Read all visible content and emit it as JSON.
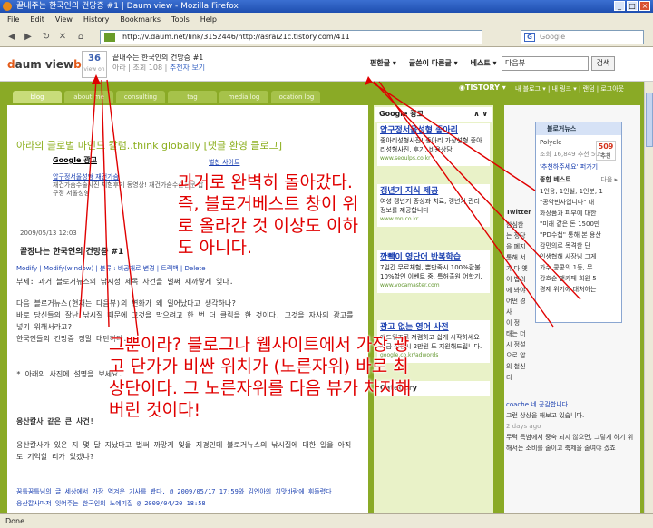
{
  "window": {
    "title": "끝내주는 한국인의 건망증 #1 | Daum view - Mozilla Firefox",
    "controls": [
      "_",
      "□",
      "×"
    ]
  },
  "menu": [
    "File",
    "Edit",
    "View",
    "History",
    "Bookmarks",
    "Tools",
    "Help"
  ],
  "nav": {
    "back": "◀",
    "forward": "▶",
    "reload": "↻",
    "stop": "✕",
    "home": "⌂",
    "url": "http://v.daum.net/link/3152446/http://asrai21c.tistory.com/411",
    "search_placeholder": "Google",
    "search_engine": "G"
  },
  "daum": {
    "logo_prefix": "d",
    "logo_main": "aum view",
    "logo_suffix": "b",
    "votes": "36",
    "votes_label": "view on",
    "post_title": "끝내주는 한국인의 건망증 #1",
    "post_meta": "아라 | 조회 108 |",
    "recommend_link": "추천자 보기",
    "nav_items": [
      "편한글 ▾",
      "글쓴이 다른글 ▾",
      "베스트 ▾"
    ],
    "search_value": "다음뷰",
    "search_button": "검색"
  },
  "blog": {
    "tabs": [
      "blog",
      "about me",
      "consulting",
      "tag",
      "media log",
      "location log"
    ],
    "tistory_label": "◉TISTORY ▾",
    "top_links": "내 블로그 ▾ | 내 링크 ▾ | 랜덤 | 로그아웃",
    "title": "아라의 글로벌 마인드 칼럼..think globally [댓글 환영 클로그]",
    "google_ad": "Google 광고",
    "ad1_title": "압구정서울성형 재건가슴",
    "ad1_text": "재건가슴수술사진 체험후기 동영상! 재건가슴수술전문 압구정 서울성형",
    "next_link": "별찬 사이트",
    "post_date": "2009/05/13 12:03",
    "post_title": "끝장나는 한국인의 건망증 #1",
    "post_links": "Modify | Modify(window) | 분류 : 비공개로 변경 | 트랙백 | Delete",
    "p1": "부제: 과거 블로거뉴스의 낚시성 제목 사건을 벌써 새까맣게 잊다.",
    "p2": "다음 블로거뉴스(현재는 다음뷰)의 변화가 왜 일어났다고 생각하나?\n바로 당신들의 잘난 낚시질 때문에 그것을 막으려고 한 번 더 클릭을 한 것이다. 그것을 자사의 광고를 넣기 위해서라고?\n한국인들의 건망증 정말 대단하다.",
    "p3": "* 아래의 사진에 설명을 보세요.",
    "p4": "응산칼사 같은 큰 사건!",
    "p5": "응산칼사가 있은 지 몇 달 지났다고 벌써 까맣게 잊을 지경인데 블로거뉴스의 낚시질에 대한 일을 아직도 기억할 리가 있겠냐?",
    "footer1": "꿈틀꿈틀님의 글 세상에서 가장 역겨운 기사를 봤다. @ 2009/05/17 17:59와 김연아의 치맛바람에 휘둘렸다",
    "footer2": "응산칼사마저 잊어주는 한국인의 노예기질 @ 2009/04/20 18:58"
  },
  "sidebar_ad": {
    "header": "Google 광고",
    "nav": "∧ ∨",
    "ads": [
      {
        "title": "압구정서울성형 종아리",
        "text": "종아리성형사진! 종아리 가상성형 종아리성형사진, 후기, 비용상담",
        "url": "www.seoulps.co.kr"
      },
      {
        "title": "갱년기 지식 제공",
        "text": "여성 갱년기 증상과 치료, 갱년기 관리 정보를 제공합니다",
        "url": "www.mn.co.kr"
      },
      {
        "title": "깐빽이 영단어 반복학습",
        "text": "7일간 무료체험, 뿐만족시 100%환불. 10%할인 이벤트 중, 특허출원 어학기.",
        "url": "www.vocamaster.com"
      },
      {
        "title": "광고 없는 영어 사전",
        "text": "애드워즈로 저렴하고 쉽게 시작하세요 지금 신청시 2만원 도 지원해드립니다.",
        "url": "google.co.kr/adwords"
      }
    ],
    "category": "Category"
  },
  "widget": {
    "title": "블로거뉴스",
    "user": "Polycle",
    "user_meta": "조회 16,849 추천 509",
    "count": "509",
    "count_label": "추천",
    "recommend": "'추천하주세요' 퍼가기",
    "best_header": "종합 베스트",
    "best_more": "다음 ▸",
    "best": [
      "1인용, 1인실, 1인분, 1",
      "\"공약빈사입니다\" 대",
      "화장품과 피부에 대한",
      "\"미래 같은 돈 1500만",
      "\"PD수첩\" 통해 본 용산",
      "감민의로 목격한 단",
      "인생협해 사장님 그게",
      "가수 콩콩의 1등, 무",
      "강호순 팬카페 회원 5",
      "경제 위기에 대처하는"
    ]
  },
  "rightcol": {
    "twitter": "Twitter",
    "lines": [
      "한심한",
      "는 정당",
      "을 폐지",
      "통해 서",
      "가 다 옛",
      "이 법의",
      "에 봐야",
      "어떤 경",
      "사",
      "이 정",
      "태는 더",
      "시 정설",
      "으로 알",
      "의 철신",
      "리",
      "coache 네 공감합니다.",
      "그런 상상을 해보고 있습니다.",
      "2 days ago",
      "무턱 득범에서 중숙 되지 않으면, 그렇게 하기 위해서는 소비를 줄이고 축제을 줄여야 겠죠"
    ]
  },
  "annotation": {
    "line1": "과거로 완벽히 돌아갔다.",
    "line2": "즉, 블로거베스트 창이 위",
    "line3": "로 올라간 것 이상도 이하",
    "line4": "도 아니다.",
    "line5": "그뿐이라? 블로그나 웹사이트에서 가장 광",
    "line6": "고 단가가 비싼 위치가 (노른자위) 바로 최",
    "line7": "상단이다. 그 노른자위를 다음 뷰가 차지해",
    "line8": "버린 것이다!"
  },
  "status": "Done"
}
